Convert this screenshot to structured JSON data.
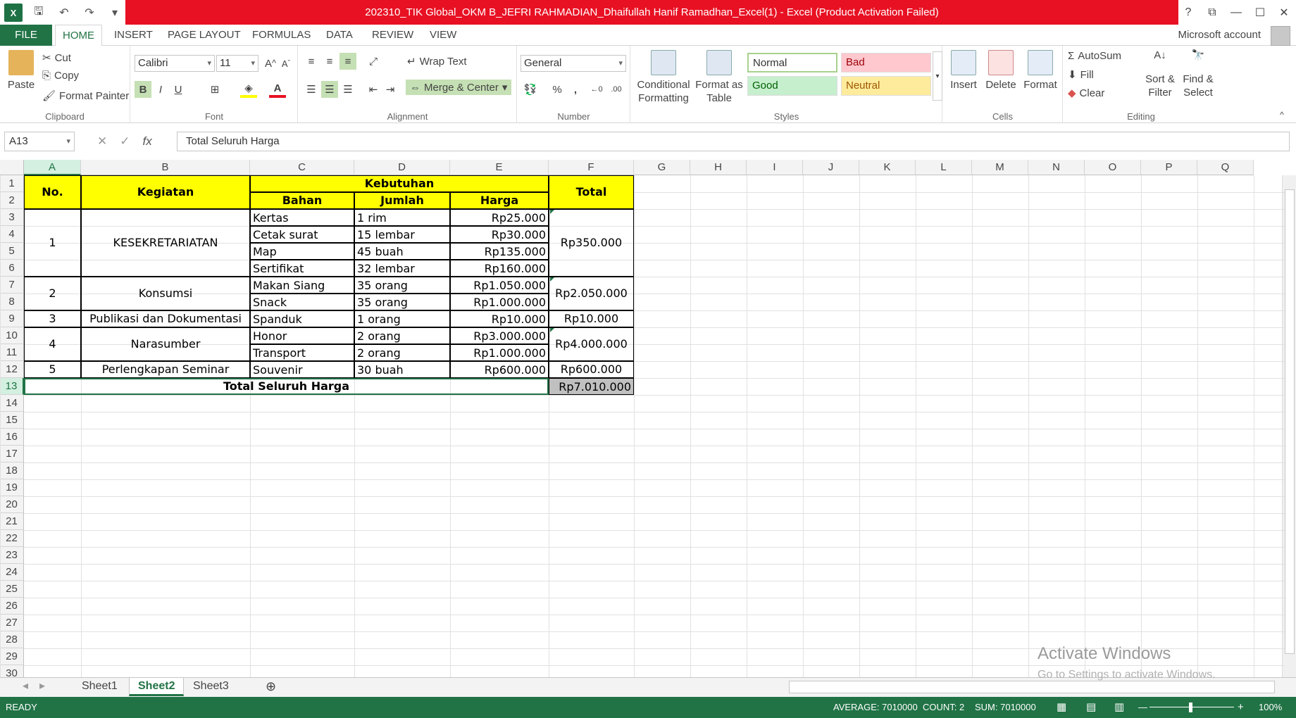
{
  "window": {
    "title": "202310_TIK Global_OKM B_JEFRI RAHMADIAN_Dhaifullah Hanif Ramadhan_Excel(1) -  Excel (Product Activation Failed)",
    "help": "?"
  },
  "tabs": [
    "FILE",
    "HOME",
    "INSERT",
    "PAGE LAYOUT",
    "FORMULAS",
    "DATA",
    "REVIEW",
    "VIEW"
  ],
  "account": "Microsoft account",
  "ribbon": {
    "clipboard": {
      "paste": "Paste",
      "cut": "Cut",
      "copy": "Copy",
      "format_painter": "Format Painter",
      "label": "Clipboard"
    },
    "font": {
      "name": "Calibri",
      "size": "11",
      "label": "Font",
      "bold": "B",
      "italic": "I",
      "underline": "U"
    },
    "alignment": {
      "wrap": "Wrap Text",
      "merge": "Merge & Center",
      "label": "Alignment"
    },
    "number": {
      "format": "General",
      "label": "Number",
      "percent": "%",
      "comma": ","
    },
    "styles": {
      "conditional": "Conditional",
      "conditional2": "Formatting",
      "format_table": "Format as",
      "format_table2": "Table",
      "normal": "Normal",
      "bad": "Bad",
      "good": "Good",
      "neutral": "Neutral",
      "label": "Styles"
    },
    "cells": {
      "insert": "Insert",
      "delete": "Delete",
      "format": "Format",
      "label": "Cells"
    },
    "editing": {
      "autosum": "AutoSum",
      "fill": "Fill",
      "clear": "Clear",
      "sort": "Sort &",
      "sort2": "Filter",
      "find": "Find &",
      "find2": "Select",
      "label": "Editing"
    }
  },
  "formula_bar": {
    "name_box": "A13",
    "content": "Total Seluruh Harga",
    "fx": "fx"
  },
  "columns": [
    "A",
    "B",
    "C",
    "D",
    "E",
    "F",
    "G",
    "H",
    "I",
    "J",
    "K",
    "L",
    "M",
    "N",
    "O",
    "P",
    "Q"
  ],
  "rows": [
    "1",
    "2",
    "3",
    "4",
    "5",
    "6",
    "7",
    "8",
    "9",
    "10",
    "11",
    "12",
    "13",
    "14",
    "15",
    "16",
    "17",
    "18",
    "19",
    "20",
    "21",
    "22",
    "23",
    "24",
    "25",
    "26",
    "27",
    "28",
    "29",
    "30"
  ],
  "table": {
    "h_no": "No.",
    "h_kegiatan": "Kegiatan",
    "h_kebutuhan": "Kebutuhan",
    "h_bahan": "Bahan",
    "h_jumlah": "Jumlah",
    "h_harga": "Harga",
    "h_total": "Total",
    "groups": [
      {
        "no": "1",
        "kegiatan": "KESEKRETARIATAN",
        "total": "Rp350.000"
      },
      {
        "no": "2",
        "kegiatan": "Konsumsi",
        "total": "Rp2.050.000"
      },
      {
        "no": "3",
        "kegiatan": "Publikasi dan Dokumentasi",
        "total": "Rp10.000"
      },
      {
        "no": "4",
        "kegiatan": "Narasumber",
        "total": "Rp4.000.000"
      },
      {
        "no": "5",
        "kegiatan": "Perlengkapan Seminar",
        "total": "Rp600.000"
      }
    ],
    "items": [
      {
        "bahan": "Kertas",
        "jumlah": "1 rim",
        "harga": "Rp25.000"
      },
      {
        "bahan": "Cetak surat",
        "jumlah": "15 lembar",
        "harga": "Rp30.000"
      },
      {
        "bahan": "Map",
        "jumlah": "45 buah",
        "harga": "Rp135.000"
      },
      {
        "bahan": "Sertifikat",
        "jumlah": "32 lembar",
        "harga": "Rp160.000"
      },
      {
        "bahan": "Makan Siang",
        "jumlah": "35 orang",
        "harga": "Rp1.050.000"
      },
      {
        "bahan": "Snack",
        "jumlah": "35 orang",
        "harga": "Rp1.000.000"
      },
      {
        "bahan": "Spanduk",
        "jumlah": "1 orang",
        "harga": "Rp10.000"
      },
      {
        "bahan": "Honor",
        "jumlah": "2 orang",
        "harga": "Rp3.000.000"
      },
      {
        "bahan": "Transport",
        "jumlah": "2 orang",
        "harga": "Rp1.000.000"
      },
      {
        "bahan": "Souvenir",
        "jumlah": "30 buah",
        "harga": "Rp600.000"
      }
    ],
    "grand_label": "Total Seluruh Harga",
    "grand_total": "Rp7.010.000"
  },
  "sheets": [
    "Sheet1",
    "Sheet2",
    "Sheet3"
  ],
  "status": {
    "ready": "READY",
    "average": "AVERAGE: 7010000",
    "count": "COUNT: 2",
    "sum": "SUM: 7010000",
    "zoom": "100%"
  },
  "watermark": {
    "line1": "Activate Windows",
    "line2": "Go to Settings to activate Windows."
  }
}
